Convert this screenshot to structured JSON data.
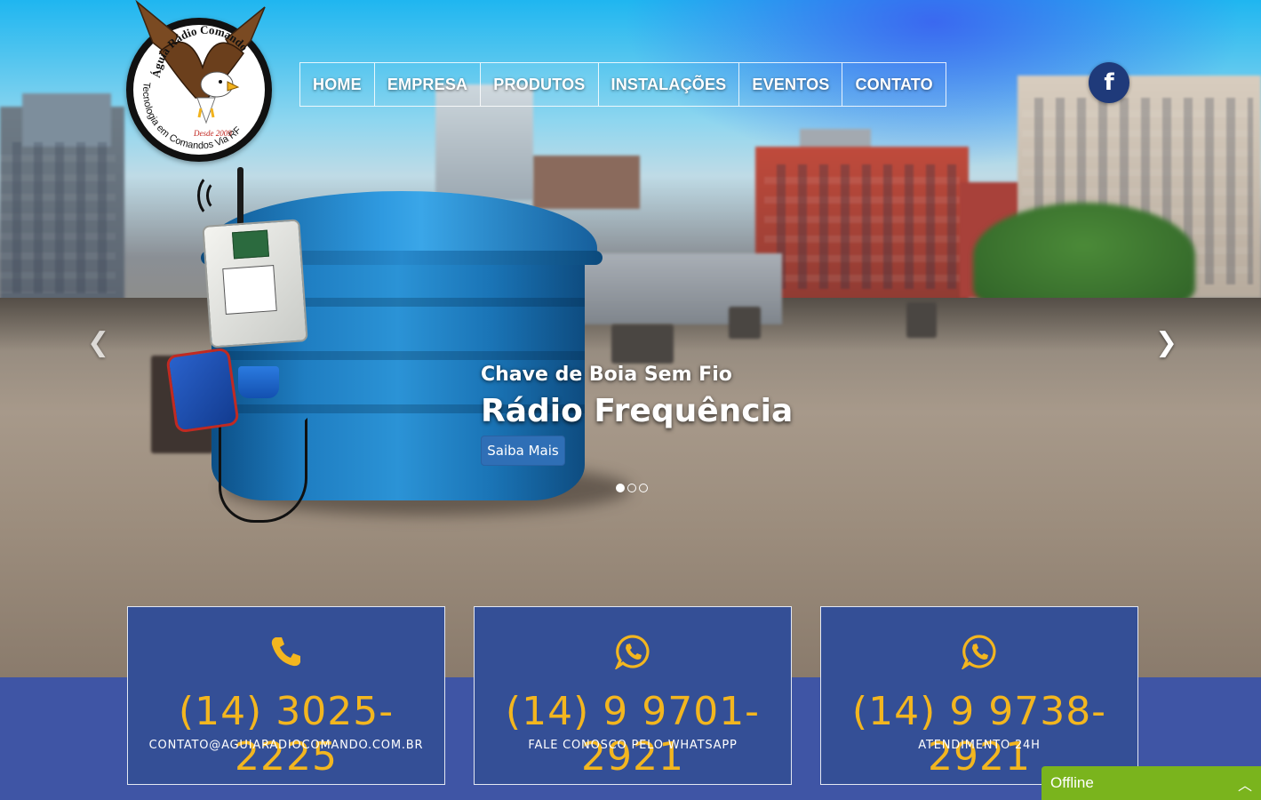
{
  "brand": {
    "logo_name": "Águia Rádio Comando",
    "logo_tagline": "Tecnologia em Comandos Via RF",
    "logo_since": "Desde 2009"
  },
  "nav": {
    "items": [
      {
        "label": "HOME"
      },
      {
        "label": "EMPRESA"
      },
      {
        "label": "PRODUTOS"
      },
      {
        "label": "INSTALAÇÕES"
      },
      {
        "label": "EVENTOS"
      },
      {
        "label": "CONTATO"
      }
    ]
  },
  "social": {
    "facebook_glyph": "f",
    "facebook_icon": "facebook-icon"
  },
  "slider": {
    "title_small": "Chave de Boia Sem Fio",
    "title_large": "Rádio Frequência",
    "button_label": "Saiba Mais",
    "prev_glyph": "❮",
    "next_glyph": "❯",
    "slide_count": 3,
    "active_slide": 1
  },
  "contacts": [
    {
      "icon": "phone-icon",
      "phone": "(14) 3025-2225",
      "sub": "CONTATO@AGUIARADIOCOMANDO.COM.BR"
    },
    {
      "icon": "whatsapp-icon",
      "phone": "(14) 9 9701-2921",
      "sub": "FALE CONOSCO PELO WHATSAPP"
    },
    {
      "icon": "whatsapp-icon",
      "phone": "(14) 9 9738-2921",
      "sub": "ATENDIMENTO 24H"
    }
  ],
  "chat": {
    "status": "Offline",
    "chevron": "︿"
  },
  "colors": {
    "accent_yellow": "#f3b61f",
    "card_blue": "#344f96",
    "band_blue": "#3f55a5",
    "chat_green": "#7ab41d",
    "facebook_blue": "#1f3a7a"
  }
}
